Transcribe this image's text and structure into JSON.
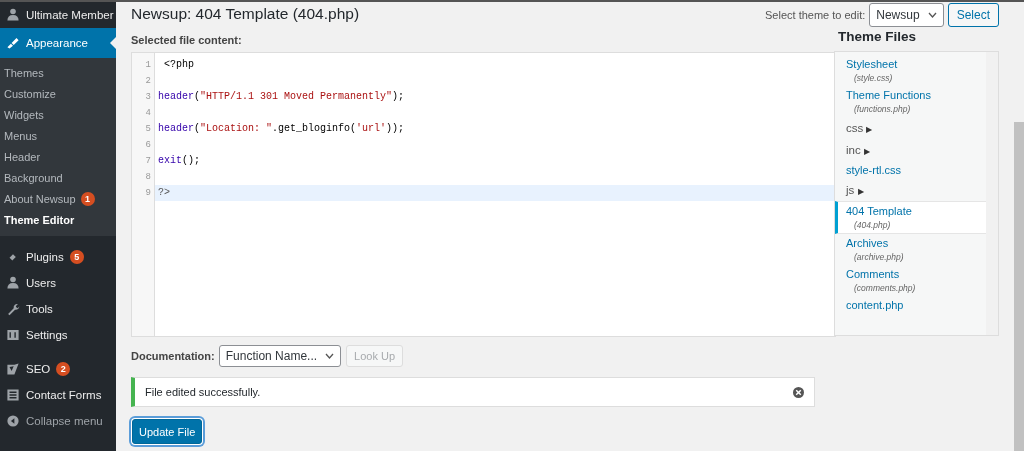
{
  "sidebar": {
    "items": [
      {
        "label": "Ultimate Member",
        "selected": false
      },
      {
        "label": "Appearance",
        "selected": true,
        "children": [
          {
            "label": "Themes",
            "selected": false
          },
          {
            "label": "Customize",
            "selected": false
          },
          {
            "label": "Widgets",
            "selected": false
          },
          {
            "label": "Menus",
            "selected": false
          },
          {
            "label": "Header",
            "selected": false
          },
          {
            "label": "Background",
            "selected": false
          },
          {
            "label": "About Newsup",
            "badge": "1",
            "selected": false
          },
          {
            "label": "Theme Editor",
            "selected": true
          }
        ]
      },
      {
        "label": "Plugins",
        "badge": "5",
        "selected": false
      },
      {
        "label": "Users",
        "selected": false
      },
      {
        "label": "Tools",
        "selected": false
      },
      {
        "label": "Settings",
        "selected": false
      },
      {
        "label": "SEO",
        "badge": "2",
        "selected": false
      },
      {
        "label": "Contact Forms",
        "selected": false
      },
      {
        "label": "Collapse menu",
        "selected": false
      }
    ]
  },
  "header": {
    "title": "Newsup: 404 Template (404.php)",
    "theme_label": "Select theme to edit:",
    "theme_value": "Newsup",
    "select_button": "Select"
  },
  "editor": {
    "label": "Selected file content:",
    "lines": [
      {
        "number": "1",
        "active": false,
        "segments": [
          {
            "kind": "plain",
            "text": " <?php"
          }
        ]
      },
      {
        "number": "2",
        "active": false
      },
      {
        "number": "3",
        "active": false,
        "segments": [
          {
            "kind": "keyword",
            "text": "header"
          },
          {
            "kind": "plain",
            "text": "("
          },
          {
            "kind": "string",
            "text": "\"HTTP/1.1 301 Moved Permanently\""
          },
          {
            "kind": "plain",
            "text": ");"
          }
        ]
      },
      {
        "number": "4",
        "active": false
      },
      {
        "number": "5",
        "active": false,
        "segments": [
          {
            "kind": "keyword",
            "text": "header"
          },
          {
            "kind": "plain",
            "text": "("
          },
          {
            "kind": "string",
            "text": "\"Location: \""
          },
          {
            "kind": "plain",
            "text": ".get_bloginfo("
          },
          {
            "kind": "string",
            "text": "'url'"
          },
          {
            "kind": "plain",
            "text": "));"
          }
        ]
      },
      {
        "number": "6",
        "active": false
      },
      {
        "number": "7",
        "active": false,
        "segments": [
          {
            "kind": "keyword",
            "text": "exit"
          },
          {
            "kind": "plain",
            "text": "();"
          }
        ]
      },
      {
        "number": "8",
        "active": false
      },
      {
        "number": "9",
        "active": true,
        "segments": [
          {
            "kind": "tag",
            "text": "?>"
          }
        ]
      }
    ]
  },
  "theme_files": {
    "title": "Theme Files",
    "items": [
      {
        "kind": "file",
        "label": "Stylesheet",
        "file": "(style.css)",
        "selected": false
      },
      {
        "kind": "file",
        "label": "Theme Functions",
        "file": "(functions.php)",
        "selected": false
      },
      {
        "kind": "folder",
        "label": "css",
        "arrow": "▶"
      },
      {
        "kind": "folder",
        "label": "inc",
        "arrow": "▶"
      },
      {
        "kind": "file",
        "label": "style-rtl.css",
        "selected": false
      },
      {
        "kind": "folder",
        "label": "js",
        "arrow": "▶"
      },
      {
        "kind": "file",
        "label": "404 Template",
        "file": "(404.php)",
        "selected": true
      },
      {
        "kind": "file",
        "label": "Archives",
        "file": "(archive.php)",
        "selected": false
      },
      {
        "kind": "file",
        "label": "Comments",
        "file": "(comments.php)",
        "selected": false
      },
      {
        "kind": "file",
        "label": "content.php",
        "selected": false
      }
    ]
  },
  "documentation": {
    "label": "Documentation:",
    "value": "Function Name...",
    "button": "Look Up",
    "button_disabled": true
  },
  "notice": {
    "text": "File edited successfully."
  },
  "update_button": "Update File"
}
